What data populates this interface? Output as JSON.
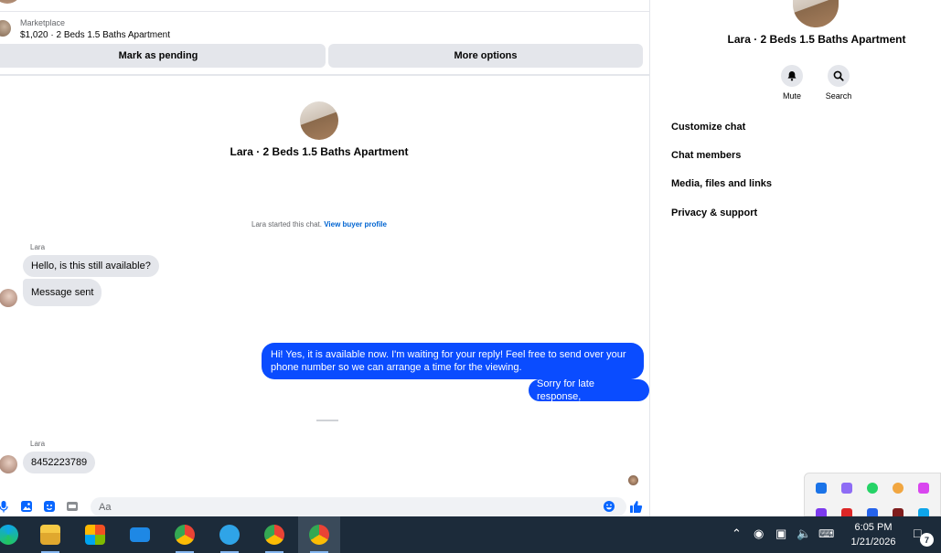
{
  "marketplace": {
    "label": "Marketplace",
    "listing": "$1,020 · 2 Beds 1.5 Baths Apartment"
  },
  "actions": {
    "pending_label": "Mark as pending",
    "more_label": "More options"
  },
  "conversation": {
    "title": "Lara · 2 Beds 1.5 Baths Apartment",
    "started_text": "Lara started this chat.",
    "buyer_profile_link": "View buyer profile",
    "messages": [
      {
        "sender": "Lara",
        "text": "Hello, is this still available?"
      },
      {
        "text": "Message sent"
      },
      {
        "text": "Hi! Yes, it is available now. I'm waiting for your reply! Feel free to send over your phone number so we can arrange a time for the viewing."
      },
      {
        "text": "Sorry for late response,"
      },
      {
        "sender": "Lara",
        "text": "8452223789"
      }
    ]
  },
  "composer": {
    "placeholder": "Aa"
  },
  "info_panel": {
    "title": "Lara · 2 Beds 1.5 Baths Apartment",
    "mute_label": "Mute",
    "search_label": "Search",
    "menu": [
      "Customize chat",
      "Chat members",
      "Media, files and links",
      "Privacy & support"
    ]
  },
  "taskbar": {
    "time": "6:05 PM",
    "date": "1/21/2026",
    "notification_count": "7"
  },
  "colors": {
    "accent": "#0866ff",
    "outgoing_bubble": "#0a4cff",
    "incoming_bubble": "#e4e6eb",
    "taskbar": "#1c2b3a"
  }
}
